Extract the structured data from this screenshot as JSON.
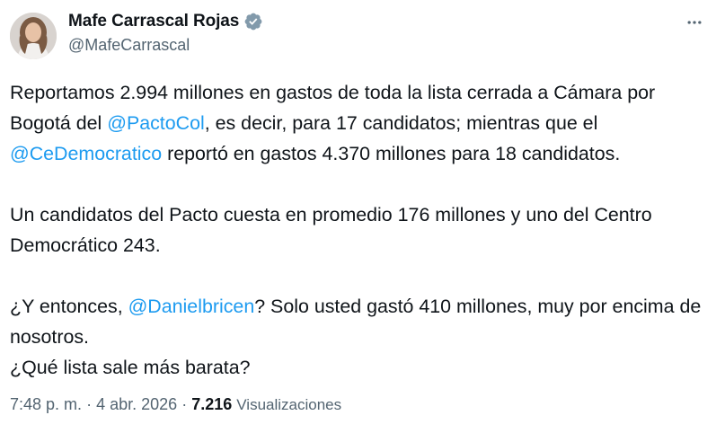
{
  "author": {
    "display_name": "Mafe Carrascal Rojas",
    "handle": "@MafeCarrascal",
    "verified": true,
    "avatar_icon": "profile-photo"
  },
  "menu": {
    "icon": "more-options-icon"
  },
  "tweet": {
    "paragraphs": [
      [
        {
          "text": "Reportamos 2.994 millones en gastos de toda la lista cerrada a Cámara por Bogotá del "
        },
        {
          "text": "@PactoCol",
          "mention": true
        },
        {
          "text": ", es decir, para 17 candidatos; mientras que el "
        },
        {
          "text": "@CeDemocratico",
          "mention": true
        },
        {
          "text": " reportó en gastos 4.370 millones para 18 candidatos."
        }
      ],
      [
        {
          "text": "Un candidatos del Pacto cuesta en promedio 176 millones y uno del Centro Democrático 243."
        }
      ],
      [
        {
          "text": "¿Y entonces, "
        },
        {
          "text": "@Danielbricen",
          "mention": true
        },
        {
          "text": "? Solo usted gastó 410 millones, muy por encima de nosotros."
        },
        {
          "break": true
        },
        {
          "text": "¿Qué lista sale más barata?"
        }
      ]
    ]
  },
  "meta": {
    "time": "7:48 p. m.",
    "separator": "·",
    "date": "4 abr. 2026",
    "views_count": "7.216",
    "views_label": "Visualizaciones"
  },
  "colors": {
    "text": "#0f1419",
    "secondary": "#536471",
    "link": "#1d9bf0",
    "verified_badge": "#829aab"
  }
}
